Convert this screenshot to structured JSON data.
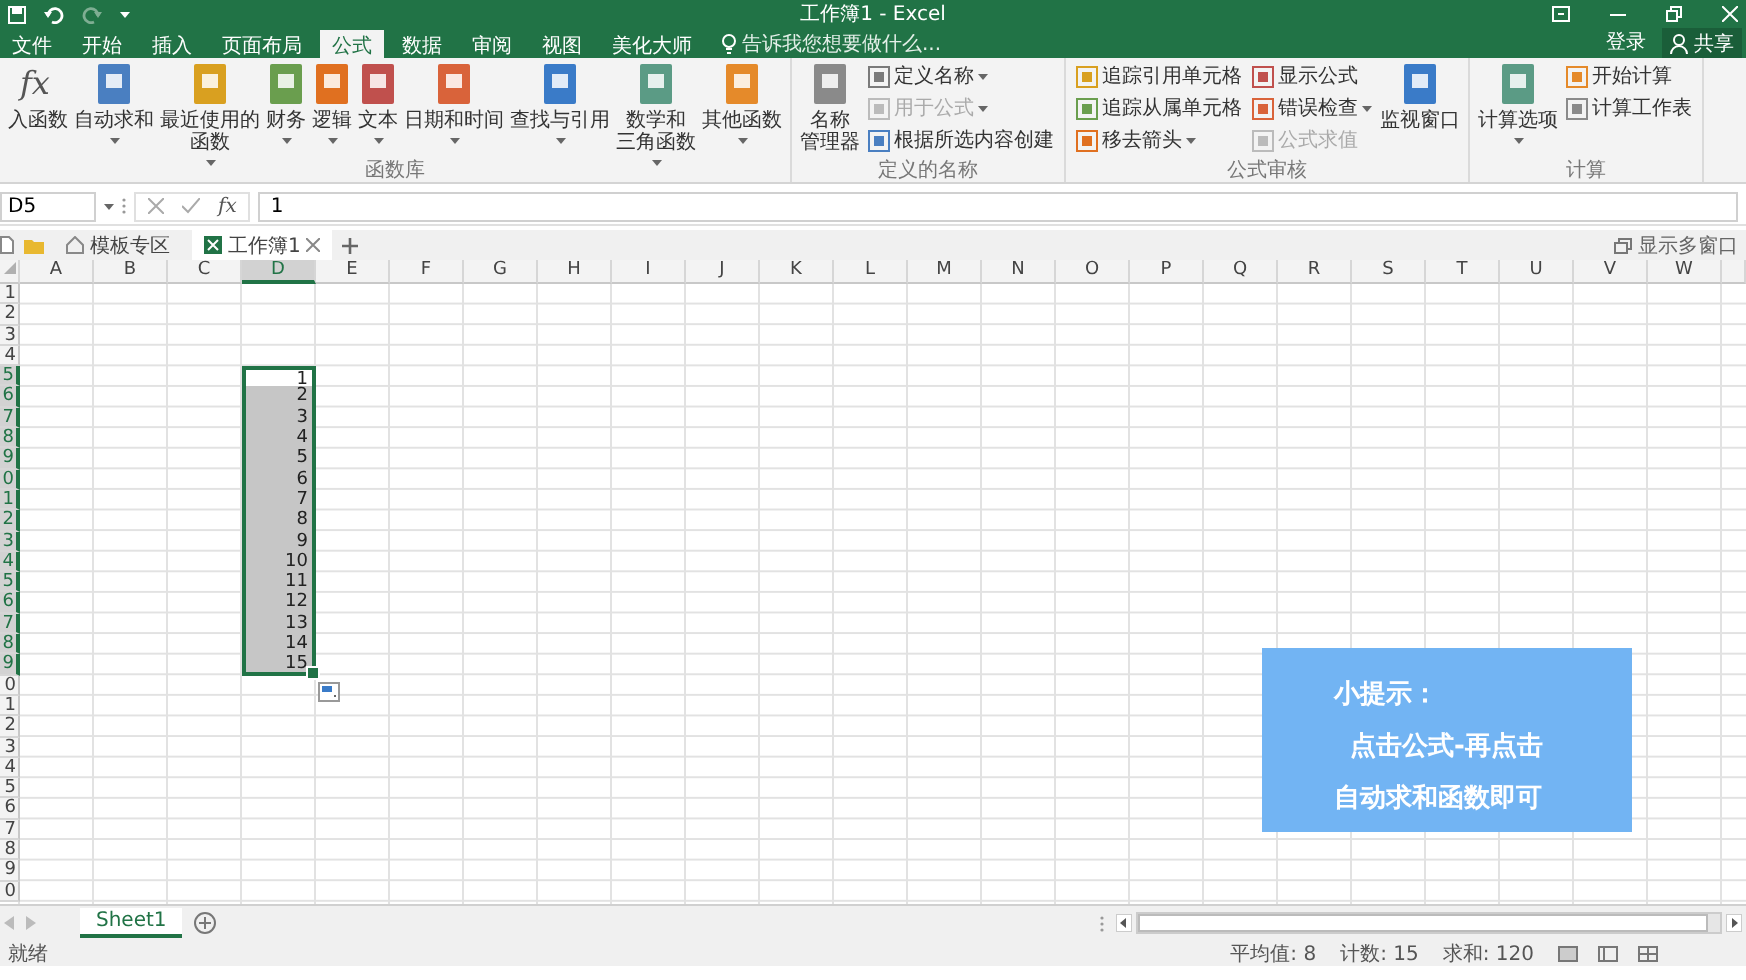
{
  "title_bar": {
    "title": "工作簿1 - Excel"
  },
  "ribbon_tabs": [
    {
      "label": "文件",
      "selected": false
    },
    {
      "label": "开始",
      "selected": false
    },
    {
      "label": "插入",
      "selected": false
    },
    {
      "label": "页面布局",
      "selected": false
    },
    {
      "label": "公式",
      "selected": true
    },
    {
      "label": "数据",
      "selected": false
    },
    {
      "label": "审阅",
      "selected": false
    },
    {
      "label": "视图",
      "selected": false
    },
    {
      "label": "美化大师",
      "selected": false
    }
  ],
  "tell_me": {
    "placeholder": "告诉我您想要做什么..."
  },
  "account": {
    "sign_in": "登录",
    "share": "共享"
  },
  "ribbon_groups": [
    {
      "label": "函数库",
      "items": [
        {
          "kind": "large",
          "lines": [
            "入函数"
          ],
          "icon_text": "fx",
          "dropdown": false,
          "disabled": false
        },
        {
          "kind": "large",
          "lines": [
            "自动求和"
          ],
          "dropdown": true,
          "disabled": false
        },
        {
          "kind": "large",
          "lines": [
            "最近使用的",
            "函数"
          ],
          "dropdown": true,
          "disabled": false
        },
        {
          "kind": "large",
          "lines": [
            "财务"
          ],
          "dropdown": true,
          "disabled": false
        },
        {
          "kind": "large",
          "lines": [
            "逻辑"
          ],
          "dropdown": true,
          "disabled": false
        },
        {
          "kind": "large",
          "lines": [
            "文本"
          ],
          "dropdown": true,
          "disabled": false
        },
        {
          "kind": "large",
          "lines": [
            "日期和时间"
          ],
          "dropdown": true,
          "disabled": false
        },
        {
          "kind": "large",
          "lines": [
            "查找与引用"
          ],
          "dropdown": true,
          "disabled": false
        },
        {
          "kind": "large",
          "lines": [
            "数学和",
            "三角函数"
          ],
          "dropdown": true,
          "disabled": false
        },
        {
          "kind": "large",
          "lines": [
            "其他函数"
          ],
          "dropdown": true,
          "disabled": false
        }
      ]
    },
    {
      "label": "定义的名称",
      "items": [
        {
          "kind": "large",
          "lines": [
            "名称",
            "管理器"
          ],
          "dropdown": false,
          "disabled": false
        },
        {
          "kind": "stack",
          "items": [
            {
              "label": "定义名称",
              "dropdown": true,
              "disabled": false
            },
            {
              "label": "用于公式",
              "dropdown": true,
              "disabled": true
            },
            {
              "label": "根据所选内容创建",
              "dropdown": false,
              "disabled": false
            }
          ]
        }
      ]
    },
    {
      "label": "公式审核",
      "items": [
        {
          "kind": "stack",
          "items": [
            {
              "label": "追踪引用单元格",
              "dropdown": false,
              "disabled": false
            },
            {
              "label": "追踪从属单元格",
              "dropdown": false,
              "disabled": false
            },
            {
              "label": "移去箭头",
              "dropdown": true,
              "disabled": false
            }
          ]
        },
        {
          "kind": "stack",
          "items": [
            {
              "label": "显示公式",
              "dropdown": false,
              "disabled": false
            },
            {
              "label": "错误检查",
              "dropdown": true,
              "disabled": false
            },
            {
              "label": "公式求值",
              "dropdown": false,
              "disabled": true
            }
          ]
        },
        {
          "kind": "large",
          "lines": [
            "监视窗口"
          ],
          "dropdown": false,
          "disabled": false
        }
      ]
    },
    {
      "label": "计算",
      "items": [
        {
          "kind": "large",
          "lines": [
            "计算选项"
          ],
          "dropdown": true,
          "disabled": false
        },
        {
          "kind": "stack",
          "items": [
            {
              "label": "开始计算",
              "dropdown": false,
              "disabled": false
            },
            {
              "label": "计算工作表",
              "dropdown": false,
              "disabled": false
            }
          ]
        }
      ]
    }
  ],
  "formula_bar": {
    "name_box": "D5",
    "fx_label": "fx",
    "formula": "1"
  },
  "doc_tabs": {
    "tabs": [
      {
        "label": "模板专区",
        "selected": false
      },
      {
        "label": "工作簿1",
        "selected": true
      }
    ],
    "show_windows": "显示多窗口"
  },
  "sheet": {
    "columns": [
      {
        "label": "A",
        "selected": false
      },
      {
        "label": "B",
        "selected": false
      },
      {
        "label": "C",
        "selected": false
      },
      {
        "label": "D",
        "selected": true
      },
      {
        "label": "E",
        "selected": false
      },
      {
        "label": "F",
        "selected": false
      },
      {
        "label": "G",
        "selected": false
      },
      {
        "label": "H",
        "selected": false
      },
      {
        "label": "I",
        "selected": false
      },
      {
        "label": "J",
        "selected": false
      },
      {
        "label": "K",
        "selected": false
      },
      {
        "label": "L",
        "selected": false
      },
      {
        "label": "M",
        "selected": false
      },
      {
        "label": "N",
        "selected": false
      },
      {
        "label": "O",
        "selected": false
      },
      {
        "label": "P",
        "selected": false
      },
      {
        "label": "Q",
        "selected": false
      },
      {
        "label": "R",
        "selected": false
      },
      {
        "label": "S",
        "selected": false
      },
      {
        "label": "T",
        "selected": false
      },
      {
        "label": "U",
        "selected": false
      },
      {
        "label": "V",
        "selected": false
      },
      {
        "label": "W",
        "selected": false
      }
    ],
    "rows": [
      {
        "label": "1",
        "selected": false,
        "active": false
      },
      {
        "label": "2",
        "selected": false,
        "active": false
      },
      {
        "label": "3",
        "selected": false,
        "active": false
      },
      {
        "label": "4",
        "selected": false,
        "active": false
      },
      {
        "label": "5",
        "selected": true,
        "active": true,
        "value": "1"
      },
      {
        "label": "6",
        "selected": true,
        "active": false,
        "value": "2"
      },
      {
        "label": "7",
        "selected": true,
        "active": false,
        "value": "3"
      },
      {
        "label": "8",
        "selected": true,
        "active": false,
        "value": "4"
      },
      {
        "label": "9",
        "selected": true,
        "active": false,
        "value": "5"
      },
      {
        "label": "0",
        "selected": true,
        "active": false,
        "value": "6"
      },
      {
        "label": "1",
        "selected": true,
        "active": false,
        "value": "7"
      },
      {
        "label": "2",
        "selected": true,
        "active": false,
        "value": "8"
      },
      {
        "label": "3",
        "selected": true,
        "active": false,
        "value": "9"
      },
      {
        "label": "4",
        "selected": true,
        "active": false,
        "value": "10"
      },
      {
        "label": "5",
        "selected": true,
        "active": false,
        "value": "11"
      },
      {
        "label": "6",
        "selected": true,
        "active": false,
        "value": "12"
      },
      {
        "label": "7",
        "selected": true,
        "active": false,
        "value": "13"
      },
      {
        "label": "8",
        "selected": true,
        "active": false,
        "value": "14"
      },
      {
        "label": "9",
        "selected": true,
        "active": false,
        "value": "15"
      },
      {
        "label": "0",
        "selected": false,
        "active": false
      },
      {
        "label": "1",
        "selected": false,
        "active": false
      },
      {
        "label": "2",
        "selected": false,
        "active": false
      },
      {
        "label": "3",
        "selected": false,
        "active": false
      },
      {
        "label": "4",
        "selected": false,
        "active": false
      },
      {
        "label": "5",
        "selected": false,
        "active": false
      },
      {
        "label": "6",
        "selected": false,
        "active": false
      },
      {
        "label": "7",
        "selected": false,
        "active": false
      },
      {
        "label": "8",
        "selected": false,
        "active": false
      },
      {
        "label": "9",
        "selected": false,
        "active": false
      },
      {
        "label": "0",
        "selected": false,
        "active": false
      }
    ]
  },
  "sheet_tabs": [
    {
      "label": "Sheet1",
      "selected": true
    }
  ],
  "status_bar": {
    "state": "就绪",
    "stats": [
      "平均值: 8",
      "计数: 15",
      "求和: 120"
    ]
  },
  "tip": {
    "title": "小提示：",
    "lines": [
      "点击公式-再点击",
      "自动求和函数即可"
    ]
  }
}
